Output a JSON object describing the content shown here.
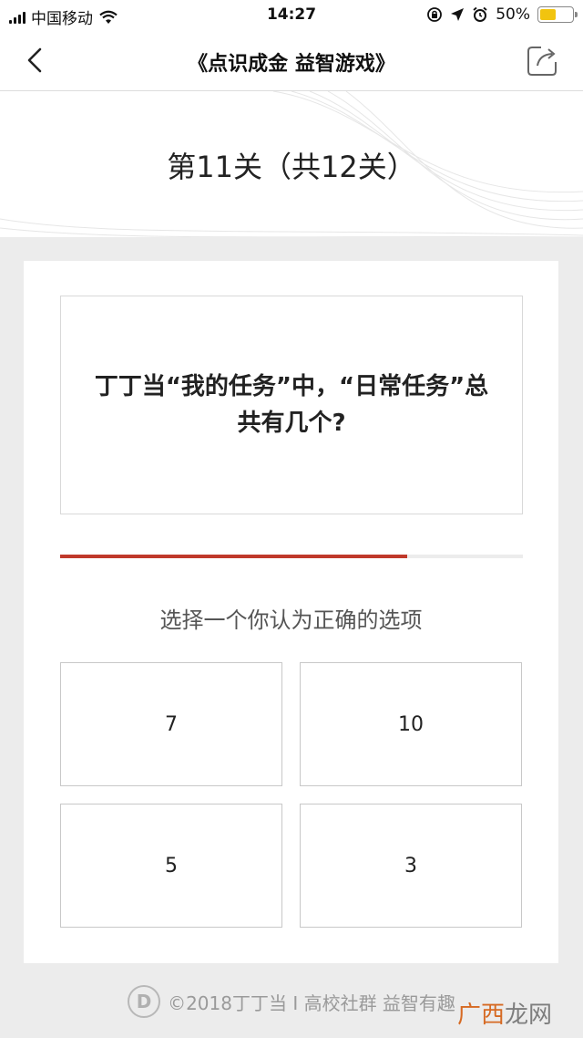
{
  "status_bar": {
    "carrier": "中国移动",
    "time": "14:27",
    "battery_percent": "50%",
    "battery_level": 0.5,
    "icons": [
      "signal-icon",
      "wifi-icon",
      "rotation-lock-icon",
      "location-icon",
      "alarm-icon",
      "battery-icon"
    ]
  },
  "nav": {
    "title": "《点识成金 益智游戏》",
    "back_icon": "chevron-left-icon",
    "share_icon": "share-icon"
  },
  "level": {
    "title": "第11关（共12关）"
  },
  "question": {
    "text": "丁丁当“我的任务”中，“日常任务”总共有几个?"
  },
  "progress": {
    "fraction": 0.75,
    "color": "#c0392b"
  },
  "instruction": "选择一个你认为正确的选项",
  "options": [
    {
      "label": "7"
    },
    {
      "label": "10"
    },
    {
      "label": "5"
    },
    {
      "label": "3"
    }
  ],
  "footer": {
    "logo_text": "D",
    "text": "©2018丁丁当 I 高校社群 益智有趣"
  },
  "watermark": {
    "part1": "广西",
    "part2": "龙网"
  }
}
